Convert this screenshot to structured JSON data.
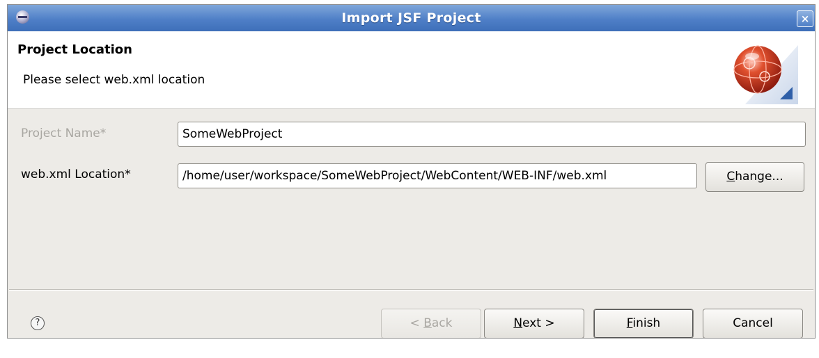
{
  "window": {
    "title": "Import JSF Project",
    "close_label": "×"
  },
  "header": {
    "title": "Project Location",
    "description": "Please select web.xml location"
  },
  "form": {
    "project_name": {
      "label": "Project Name*",
      "value": "SomeWebProject",
      "enabled": false
    },
    "webxml_location": {
      "label": "web.xml Location*",
      "value": "/home/user/workspace/SomeWebProject/WebContent/WEB-INF/web.xml"
    },
    "change_button": {
      "mnemonic": "C",
      "rest": "hange..."
    }
  },
  "footer": {
    "help_icon": "?",
    "back_button": {
      "prefix": "< ",
      "mnemonic": "B",
      "rest": "ack",
      "enabled": false
    },
    "next_button": {
      "mnemonic": "N",
      "rest": "ext >"
    },
    "finish_button": {
      "mnemonic": "F",
      "rest": "inish"
    },
    "cancel_button": {
      "label": "Cancel"
    }
  },
  "icons": {
    "app": "eclipse-icon",
    "banner": "jsf-wizard-graphic",
    "help": "help-icon"
  }
}
